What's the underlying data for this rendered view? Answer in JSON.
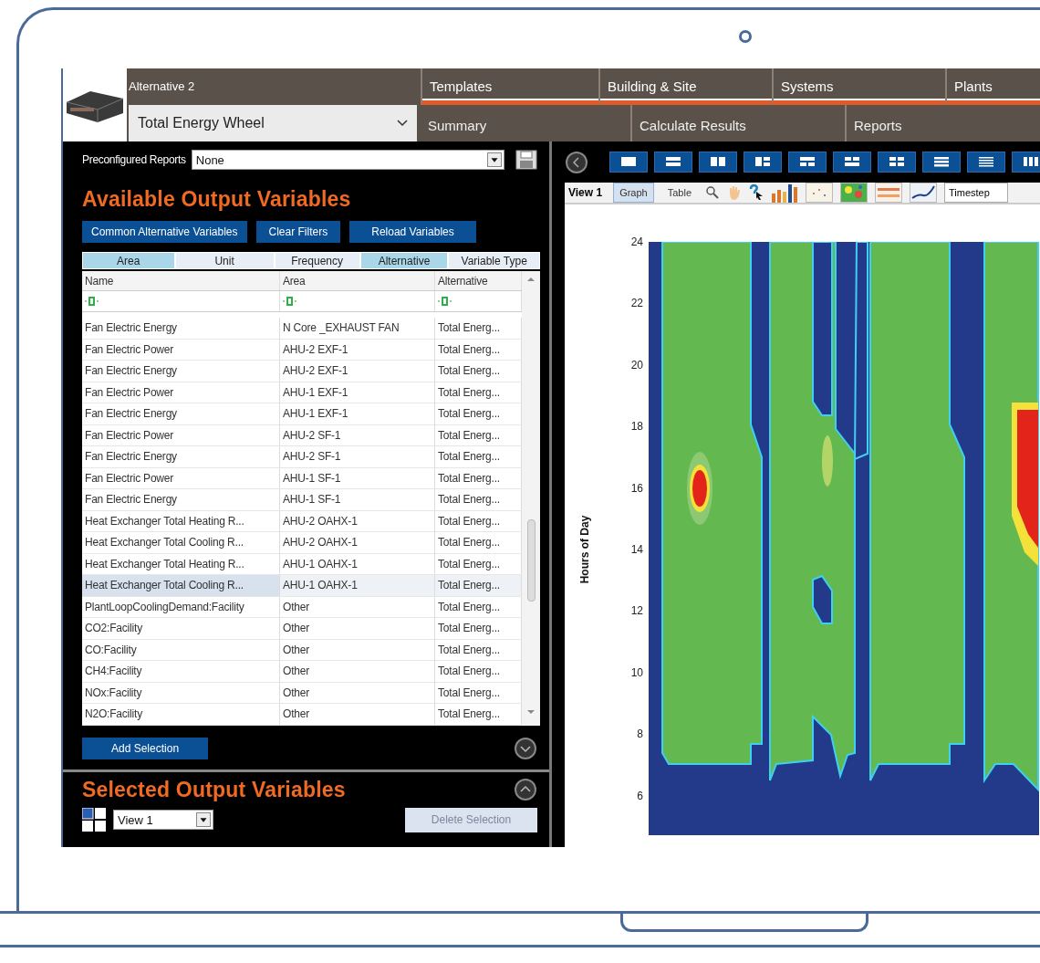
{
  "header": {
    "alternative_label": "Alternative 2",
    "alternative_select": "Total Energy Wheel",
    "nav_top": [
      {
        "label": "Templates"
      },
      {
        "label": "Building & Site"
      },
      {
        "label": "Systems"
      },
      {
        "label": "Plants"
      }
    ],
    "nav_bottom": [
      {
        "label": "Summary"
      },
      {
        "label": "Calculate Results"
      },
      {
        "label": "Reports"
      }
    ]
  },
  "left_panel": {
    "preconfigured_label": "Preconfigured Reports",
    "preconfigured_select": "None",
    "available_title": "Available Output Variables",
    "buttons": [
      "Common Alternative Variables",
      "Clear Filters",
      "Reload Variables"
    ],
    "filter_tabs": [
      {
        "label": "Area",
        "selected": true
      },
      {
        "label": "Unit",
        "selected": false
      },
      {
        "label": "Frequency",
        "selected": false
      },
      {
        "label": "Alternative",
        "selected": true
      },
      {
        "label": "Variable Type",
        "selected": false
      }
    ],
    "table": {
      "columns": [
        "Name",
        "Area",
        "Alternative"
      ],
      "rows": [
        {
          "cells": [
            "Fan Electric Energy",
            "N Core _EXHAUST FAN",
            "Total Energ..."
          ],
          "selected": false
        },
        {
          "cells": [
            "Fan Electric Power",
            "AHU-2 EXF-1",
            "Total Energ..."
          ],
          "selected": false
        },
        {
          "cells": [
            "Fan Electric Energy",
            "AHU-2 EXF-1",
            "Total Energ..."
          ],
          "selected": false
        },
        {
          "cells": [
            "Fan Electric Power",
            "AHU-1 EXF-1",
            "Total Energ..."
          ],
          "selected": false
        },
        {
          "cells": [
            "Fan Electric Energy",
            "AHU-1 EXF-1",
            "Total Energ..."
          ],
          "selected": false
        },
        {
          "cells": [
            "Fan Electric Power",
            "AHU-2 SF-1",
            "Total Energ..."
          ],
          "selected": false
        },
        {
          "cells": [
            "Fan Electric Energy",
            "AHU-2 SF-1",
            "Total Energ..."
          ],
          "selected": false
        },
        {
          "cells": [
            "Fan Electric Power",
            "AHU-1 SF-1",
            "Total Energ..."
          ],
          "selected": false
        },
        {
          "cells": [
            "Fan Electric Energy",
            "AHU-1 SF-1",
            "Total Energ..."
          ],
          "selected": false
        },
        {
          "cells": [
            "Heat Exchanger Total Heating R...",
            "AHU-2 OAHX-1",
            "Total Energ..."
          ],
          "selected": false
        },
        {
          "cells": [
            "Heat Exchanger Total Cooling R...",
            "AHU-2 OAHX-1",
            "Total Energ..."
          ],
          "selected": false
        },
        {
          "cells": [
            "Heat Exchanger Total Heating R...",
            "AHU-1 OAHX-1",
            "Total Energ..."
          ],
          "selected": false
        },
        {
          "cells": [
            "Heat Exchanger Total Cooling R...",
            "AHU-1 OAHX-1",
            "Total Energ..."
          ],
          "selected": true
        },
        {
          "cells": [
            "PlantLoopCoolingDemand:Facility",
            "Other",
            "Total Energ..."
          ],
          "selected": false
        },
        {
          "cells": [
            "CO2:Facility",
            "Other",
            "Total Energ..."
          ],
          "selected": false
        },
        {
          "cells": [
            "CO:Facility",
            "Other",
            "Total Energ..."
          ],
          "selected": false
        },
        {
          "cells": [
            "CH4:Facility",
            "Other",
            "Total Energ..."
          ],
          "selected": false
        },
        {
          "cells": [
            "NOx:Facility",
            "Other",
            "Total Energ..."
          ],
          "selected": false
        },
        {
          "cells": [
            "N2O:Facility",
            "Other",
            "Total Energ..."
          ],
          "selected": false
        }
      ]
    },
    "add_button": "Add Selection",
    "selected_title": "Selected Output Variables",
    "view_select": "View 1",
    "delete_button": {
      "label": "Delete Selection",
      "disabled": true
    }
  },
  "right_panel": {
    "view_title": "View 1",
    "view_tabs": [
      {
        "label": "Graph",
        "selected": true
      },
      {
        "label": "Table",
        "selected": false
      }
    ],
    "timestep_field": "Timestep",
    "chart": {
      "ylabel": "Hours of Day",
      "yticks": [
        "24",
        "22",
        "20",
        "18",
        "16",
        "14",
        "12",
        "10",
        "8",
        "6"
      ]
    }
  }
}
